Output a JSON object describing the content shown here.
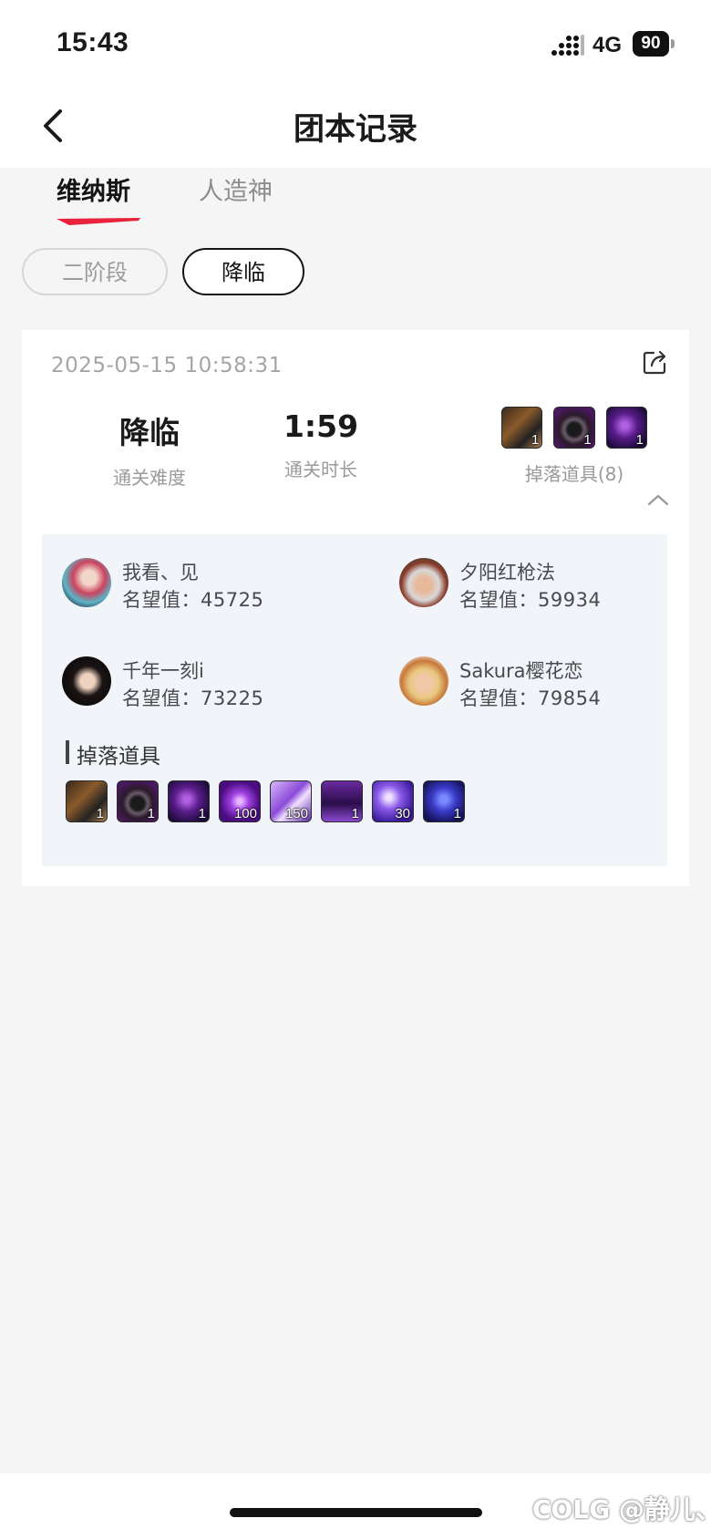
{
  "status_bar": {
    "time": "15:43",
    "network": "4G",
    "battery": "90"
  },
  "nav": {
    "title": "团本记录"
  },
  "tabs": [
    {
      "label": "维纳斯",
      "active": true
    },
    {
      "label": "人造神",
      "active": false
    }
  ],
  "filters": [
    {
      "label": "二阶段",
      "selected": false
    },
    {
      "label": "降临",
      "selected": true
    }
  ],
  "record": {
    "datetime": "2025-05-15 10:58:31",
    "difficulty": {
      "value": "降临",
      "label": "通关难度"
    },
    "duration": {
      "value": "1:59",
      "label": "通关时长"
    },
    "drops_summary": {
      "label": "掉落道具(8)",
      "items": [
        {
          "icon": "armor-item-icon",
          "qty": "1"
        },
        {
          "icon": "ring-item-icon",
          "qty": "1"
        },
        {
          "icon": "purple-orb-item-icon",
          "qty": "1"
        }
      ]
    },
    "members": [
      {
        "name": "我看、见",
        "rep_label": "名望值：",
        "rep": "45725"
      },
      {
        "name": "夕阳红枪法",
        "rep_label": "名望值：",
        "rep": "59934"
      },
      {
        "name": "千年一刻i",
        "rep_label": "名望值：",
        "rep": "73225"
      },
      {
        "name": "Sakura樱花恋",
        "rep_label": "名望值：",
        "rep": "79854"
      }
    ],
    "drops_detail": {
      "title": "掉落道具",
      "items": [
        {
          "icon": "armor-item-icon",
          "qty": "1"
        },
        {
          "icon": "ring-item-icon",
          "qty": "1"
        },
        {
          "icon": "purple-orb-item-icon",
          "qty": "1"
        },
        {
          "icon": "purple-sphere-item-icon",
          "qty": "100"
        },
        {
          "icon": "purple-crystal-item-icon",
          "qty": "150"
        },
        {
          "icon": "purple-box-item-icon",
          "qty": "1"
        },
        {
          "icon": "purple-shard-item-icon",
          "qty": "30"
        },
        {
          "icon": "blue-orb-item-icon",
          "qty": "1"
        }
      ]
    }
  },
  "watermark": "COLG @静儿、",
  "colors": {
    "accent": "#e8223a",
    "card_bg": "#ffffff",
    "party_bg": "#f1f4f9",
    "page_bg": "#f5f5f6"
  }
}
